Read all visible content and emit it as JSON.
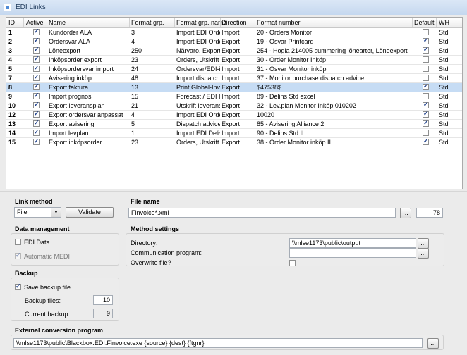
{
  "window": {
    "title": "EDI Links"
  },
  "grid": {
    "columns": [
      "ID",
      "Active",
      "Name",
      "Format grp.",
      "Format grp. name",
      "Direction",
      "Format number",
      "Default",
      "WH"
    ],
    "rows": [
      {
        "id": "1",
        "active": true,
        "name": "Kundorder ALA",
        "fgrp": "3",
        "fgrpname": "Import EDI Order",
        "dir": "Import",
        "fnum": "20 - Orders Monitor",
        "def": false,
        "wh": "Std"
      },
      {
        "id": "2",
        "active": true,
        "name": "Ordersvar ALA",
        "fgrp": "4",
        "fgrpname": "Import EDI Order",
        "dir": "Export",
        "fnum": "19 - Osvar Printcard",
        "def": true,
        "wh": "Std"
      },
      {
        "id": "3",
        "active": true,
        "name": "Löneexport",
        "fgrp": "250",
        "fgrpname": "Närvaro, Export",
        "dir": "Export",
        "fnum": "254 - Hogia 214005 summering lönearter, Löneexport",
        "def": true,
        "wh": "Std"
      },
      {
        "id": "4",
        "active": true,
        "name": "Inköpsorder export",
        "fgrp": "23",
        "fgrpname": "Orders, Utskrift i",
        "dir": "Export",
        "fnum": "30 - Order Monitor Inköp",
        "def": false,
        "wh": "Std"
      },
      {
        "id": "5",
        "active": true,
        "name": "Inköpsordersvar import",
        "fgrp": "24",
        "fgrpname": "Ordersvar/EDI-in",
        "dir": "Import",
        "fnum": "31 - Osvar Monitor inköp",
        "def": false,
        "wh": "Std"
      },
      {
        "id": "7",
        "active": true,
        "name": "Avisering inköp",
        "fgrp": "48",
        "fgrpname": "Import dispatch a",
        "dir": "Import",
        "fnum": "37 - Monitor purchase dispatch advice",
        "def": false,
        "wh": "Std"
      },
      {
        "id": "8",
        "active": true,
        "name": "Export faktura",
        "fgrp": "13",
        "fgrpname": "Print Global-Invoi",
        "dir": "Export",
        "fnum": "$47538$",
        "def": true,
        "wh": "Std",
        "selected": true
      },
      {
        "id": "9",
        "active": true,
        "name": "Import prognos",
        "fgrp": "15",
        "fgrpname": "Forecast / EDI In",
        "dir": "Import",
        "fnum": "89 - Delins Std excel",
        "def": false,
        "wh": "Std"
      },
      {
        "id": "10",
        "active": true,
        "name": "Export leveransplan",
        "fgrp": "21",
        "fgrpname": "Utskrift leveransp",
        "dir": "Export",
        "fnum": "32 - Lev.plan Monitor Inköp 010202",
        "def": true,
        "wh": "Std"
      },
      {
        "id": "12",
        "active": true,
        "name": "Export ordersvar anpassat",
        "fgrp": "4",
        "fgrpname": "Import EDI Order",
        "dir": "Export",
        "fnum": "10020",
        "def": true,
        "wh": "Std"
      },
      {
        "id": "13",
        "active": true,
        "name": "Export avisering",
        "fgrp": "5",
        "fgrpname": "Dispatch advice,",
        "dir": "Export",
        "fnum": "85 - Avisering Alliance 2",
        "def": true,
        "wh": "Std"
      },
      {
        "id": "14",
        "active": true,
        "name": "Import levplan",
        "fgrp": "1",
        "fgrpname": "Import EDI Delive",
        "dir": "Import",
        "fnum": "90 - Delins Std II",
        "def": false,
        "wh": "Std"
      },
      {
        "id": "15",
        "active": true,
        "name": "Export inköpsorder",
        "fgrp": "23",
        "fgrpname": "Orders, Utskrift i",
        "dir": "Export",
        "fnum": "38 - Order Monitor inköp II",
        "def": true,
        "wh": "Std"
      }
    ]
  },
  "link_method": {
    "label": "Link method",
    "value": "File",
    "validate_label": "Validate"
  },
  "file_name": {
    "label": "File name",
    "value": "Finvoice*.xml",
    "browse": "...",
    "number": "78"
  },
  "data_management": {
    "label": "Data management",
    "edi_data": "EDI Data",
    "automatic_medi": "Automatic MEDI"
  },
  "backup": {
    "label": "Backup",
    "save_label": "Save backup file",
    "files_label": "Backup files:",
    "files_value": "10",
    "current_label": "Current backup:",
    "current_value": "9"
  },
  "method_settings": {
    "label": "Method settings",
    "directory_label": "Directory:",
    "directory_value": "\\\\mlse1173\\public\\output",
    "comm_label": "Communication program:",
    "comm_value": "",
    "overwrite_label": "Overwrite file?",
    "browse": "..."
  },
  "external": {
    "label": "External conversion program",
    "value": "\\\\mlse1173\\public\\Blackbox.EDI.Finvoice.exe {source} {dest} {ftgnr}",
    "browse": "..."
  }
}
